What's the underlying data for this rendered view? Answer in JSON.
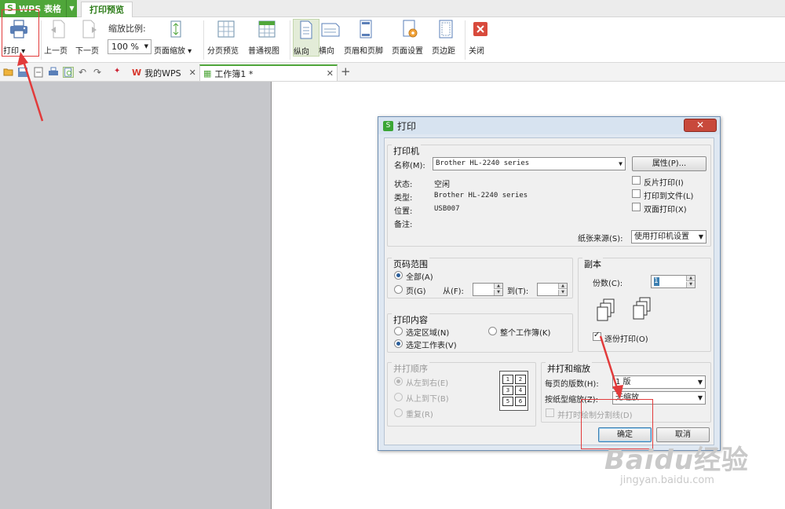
{
  "app": {
    "name": "WPS 表格",
    "logo_letter": "S"
  },
  "ribbon_tabs": {
    "print_preview": "打印预览"
  },
  "ribbon": {
    "print": "打印",
    "prev_page": "上一页",
    "next_page": "下一页",
    "zoom_label": "缩放比例:",
    "zoom_value": "100 %",
    "page_zoom": "页面缩放",
    "page_break_preview": "分页预览",
    "normal_view": "普通视图",
    "portrait": "纵向",
    "landscape": "横向",
    "header_footer": "页眉和页脚",
    "page_setup": "页面设置",
    "margins": "页边距",
    "close": "关闭"
  },
  "doc_tabs": [
    {
      "label": "我的WPS"
    },
    {
      "label": "工作簿1 *"
    }
  ],
  "dialog": {
    "title": "打印",
    "printer": {
      "group": "打印机",
      "name_label": "名称(M):",
      "name_value": "Brother HL-2240 series",
      "properties_btn": "属性(P)...",
      "status_label": "状态:",
      "status_value": "空闲",
      "type_label": "类型:",
      "type_value": "Brother HL-2240 series",
      "location_label": "位置:",
      "location_value": "USB007",
      "comment_label": "备注:",
      "reverse_print": "反片打印(I)",
      "print_to_file": "打印到文件(L)",
      "duplex": "双面打印(X)",
      "paper_source_label": "纸张来源(S):",
      "paper_source_value": "使用打印机设置"
    },
    "page_range": {
      "group": "页码范围",
      "all": "全部(A)",
      "pages": "页(G)",
      "from": "从(F):",
      "to": "到(T):"
    },
    "copies": {
      "group": "副本",
      "count_label": "份数(C):",
      "count_value": "1",
      "collate": "逐份打印(O)"
    },
    "print_content": {
      "group": "打印内容",
      "selection": "选定区域(N)",
      "whole_workbook": "整个工作簿(K)",
      "active_sheet": "选定工作表(V)"
    },
    "print_order": {
      "group": "并打顺序",
      "left_to_right": "从左到右(E)",
      "top_to_bottom": "从上到下(B)",
      "repeat": "重复(R)",
      "cells": [
        "1",
        "2",
        "3",
        "4",
        "5",
        "6"
      ]
    },
    "scaling": {
      "group": "并打和缩放",
      "pages_per_sheet_label": "每页的版数(H):",
      "pages_per_sheet_value": "1 版",
      "scale_to_paper_label": "按纸型缩放(Z):",
      "scale_to_paper_value": "无缩放",
      "draw_borders": "并打时绘制分割线(D)"
    },
    "ok": "确定",
    "cancel": "取消"
  },
  "watermark": {
    "brand": "Baidu",
    "brand_cn": "经验",
    "url": "jingyan.baidu.com"
  },
  "colors": {
    "wps_green": "#4fa63a",
    "annotation_red": "#e23b3b",
    "gray_pane": "#c6c7cb"
  }
}
